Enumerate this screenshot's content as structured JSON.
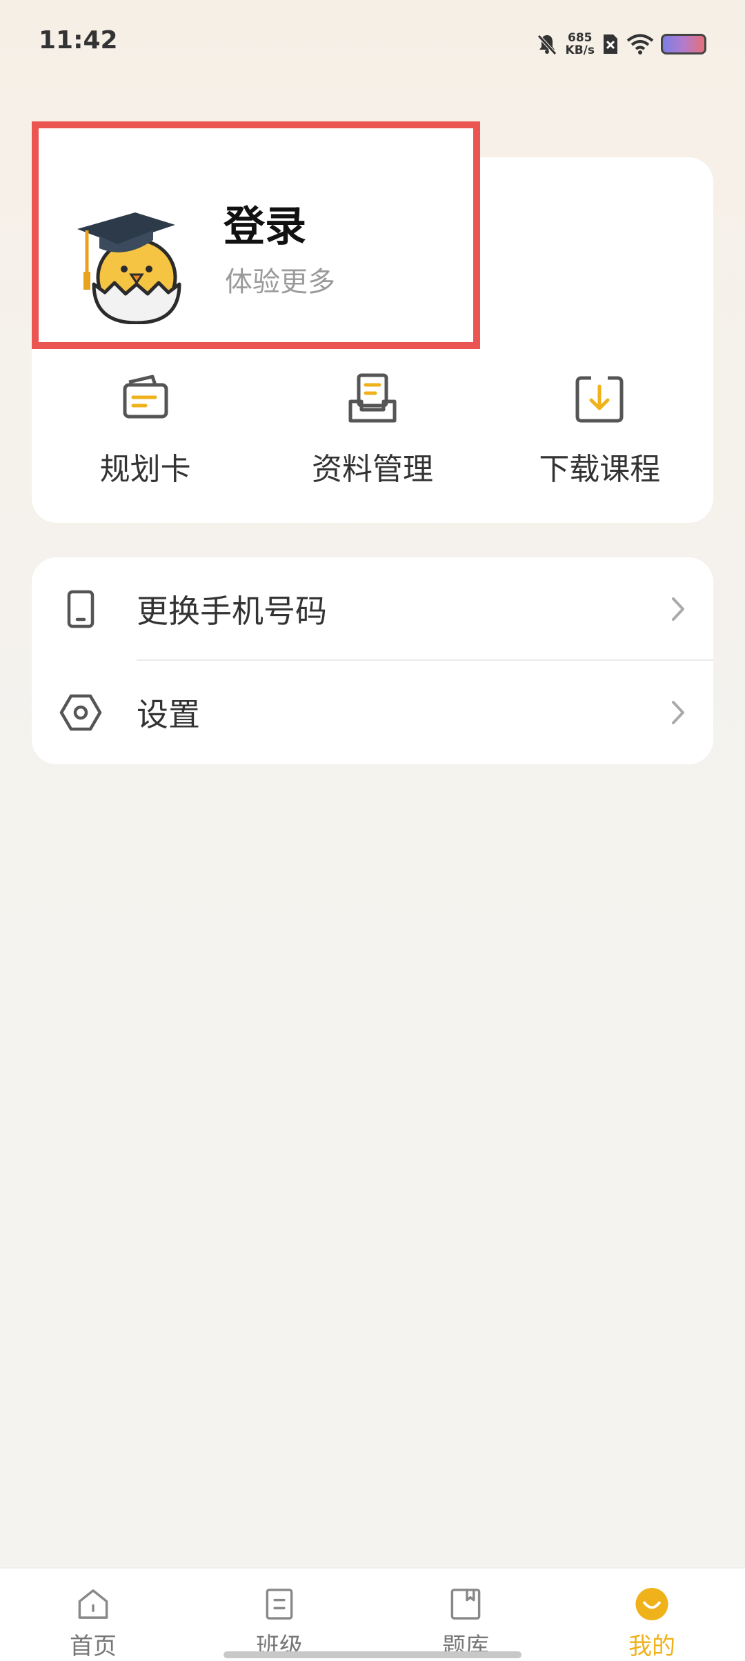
{
  "status_bar": {
    "time": "11:42",
    "net_speed_value": "685",
    "net_speed_unit": "KB/s"
  },
  "profile": {
    "title": "登录",
    "subtitle": "体验更多"
  },
  "quick_actions": [
    {
      "label": "规划卡",
      "icon": "planning-card-icon"
    },
    {
      "label": "资料管理",
      "icon": "materials-icon"
    },
    {
      "label": "下载课程",
      "icon": "download-icon"
    }
  ],
  "menu": [
    {
      "label": "更换手机号码",
      "icon": "phone-icon"
    },
    {
      "label": "设置",
      "icon": "settings-icon"
    }
  ],
  "tabs": [
    {
      "label": "首页",
      "icon": "home-icon",
      "active": false
    },
    {
      "label": "班级",
      "icon": "class-icon",
      "active": false
    },
    {
      "label": "题库",
      "icon": "question-bank-icon",
      "active": false
    },
    {
      "label": "我的",
      "icon": "me-icon",
      "active": true
    }
  ],
  "colors": {
    "accent": "#f0b21b",
    "highlight": "#ea5451",
    "icon_gray": "#555555"
  }
}
